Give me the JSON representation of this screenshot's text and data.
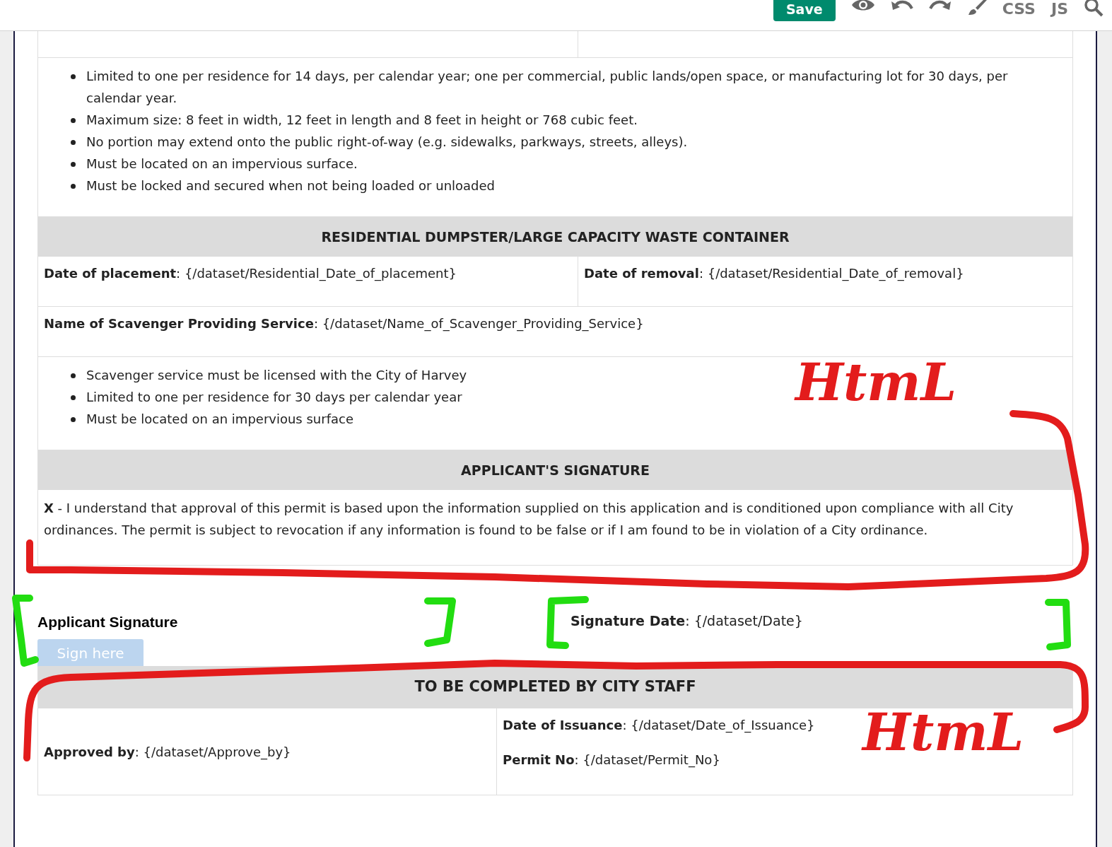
{
  "toolbar": {
    "save": "Save",
    "items": [
      {
        "kind": "eye"
      },
      {
        "kind": "undo"
      },
      {
        "kind": "redo"
      },
      {
        "kind": "brush"
      },
      {
        "kind": "text",
        "label": "CSS"
      },
      {
        "kind": "text",
        "label": "JS"
      },
      {
        "kind": "search"
      }
    ]
  },
  "blocks": [
    {
      "kind": "cut_row"
    },
    {
      "kind": "bullets",
      "items": [
        "Limited to one per residence for 14 days, per calendar year; one per commercial, public lands/open space, or manufacturing lot for 30 days, per calendar year.",
        "Maximum size: 8 feet in width, 12 feet in length and 8 feet in height or 768 cubic feet.",
        "No portion may extend onto the public right-of-way (e.g. sidewalks, parkways, streets, alleys).",
        "Must be located on an impervious surface.",
        "Must be locked and secured when not being loaded or unloaded"
      ]
    },
    {
      "kind": "header",
      "text": "RESIDENTIAL DUMPSTER/LARGE CAPACITY WASTE CONTAINER"
    },
    {
      "kind": "fields",
      "cells": [
        "**Date of placement**: {/dataset/Residential_Date_of_placement}",
        "**Date of removal**: {/dataset/Residential_Date_of_removal}"
      ]
    },
    {
      "kind": "fields",
      "cells": [
        "**Name of Scavenger Providing Service**: {/dataset/Name_of_Scavenger_Providing_Service}"
      ]
    },
    {
      "kind": "bullets",
      "items": [
        "Scavenger service must be licensed with the City of Harvey",
        "Limited to one per residence for 30 days per calendar year",
        "Must be located on an impervious surface"
      ]
    },
    {
      "kind": "header",
      "text": "APPLICANT'S SIGNATURE"
    },
    {
      "kind": "paragraph",
      "text": "**X** - I understand that approval of this permit is based upon the information supplied on this application and is conditioned upon compliance with all City ordinances. The permit is subject to revocation if any information is found to be false or if I am found to be in violation of a City ordinance."
    }
  ],
  "signature": {
    "label": "Applicant Signature",
    "button": "Sign here",
    "date": "**Signature Date**: {/dataset/Date}"
  },
  "staff": {
    "header": "TO BE COMPLETED BY CITY STAFF",
    "left": "**Approved by**: {/dataset/Approve_by}",
    "right": [
      "**Date of Issuance**: {/dataset/Date_of_Issuance}",
      "**Permit No**: {/dataset/Permit_No}"
    ]
  },
  "annotations": [
    {
      "text": "HtmL"
    },
    {
      "text": "HtmL"
    }
  ]
}
